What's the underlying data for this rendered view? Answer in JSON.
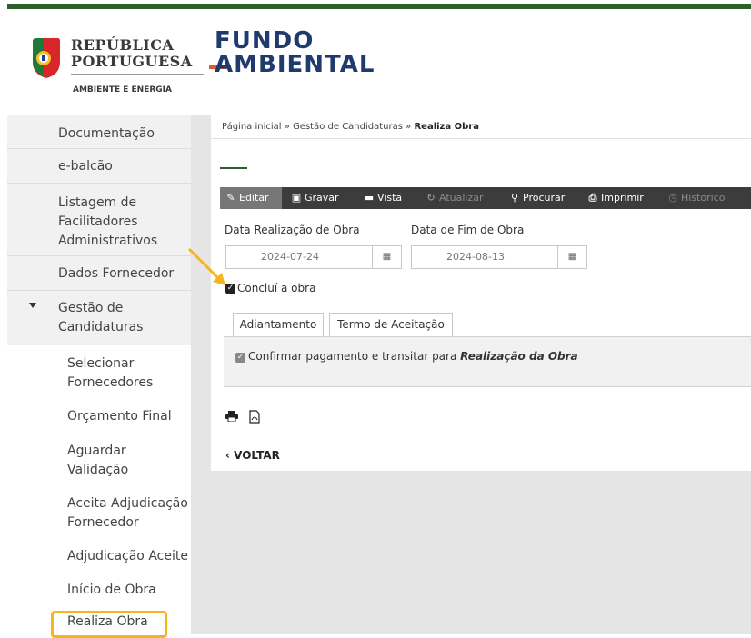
{
  "header": {
    "republica_line1": "REPÚBLICA",
    "republica_line2": "PORTUGUESA",
    "republica_sub": "AMBIENTE E ENERGIA",
    "fundo_line1": "FUNDO",
    "fundo_line2": "AMBIENTAL"
  },
  "sidebar": {
    "items": [
      {
        "label": "Documentação"
      },
      {
        "label": "e-balcão"
      },
      {
        "label": "Listagem de Facilitadores Administrativos"
      },
      {
        "label": "Dados Fornecedor"
      },
      {
        "label": "Gestão de Candidaturas"
      }
    ],
    "subitems": [
      {
        "label": "Selecionar Fornecedores"
      },
      {
        "label": "Orçamento Final"
      },
      {
        "label": "Aguardar Validação"
      },
      {
        "label": "Aceita Adjudicação Fornecedor"
      },
      {
        "label": "Adjudicação Aceite"
      },
      {
        "label": "Início de Obra"
      },
      {
        "label": "Realiza Obra"
      }
    ]
  },
  "breadcrumb": {
    "home": "Página inicial",
    "sep": "»",
    "level2": "Gestão de Candidaturas",
    "current": "Realiza Obra"
  },
  "toolbar": {
    "editar": "Editar",
    "gravar": "Gravar",
    "vista": "Vista",
    "atualizar": "Atualizar",
    "procurar": "Procurar",
    "imprimir": "Imprimir",
    "historico": "Historico"
  },
  "form": {
    "data_realizacao_label": "Data Realização de Obra",
    "data_realizacao_value": "2024-07-24",
    "data_fim_label": "Data de Fim de Obra",
    "data_fim_value": "2024-08-13",
    "conclui_label": "Concluí a obra",
    "conclui_checked": true
  },
  "tabs": [
    {
      "label": "Adiantamento"
    },
    {
      "label": "Termo de Aceitação"
    }
  ],
  "tab_panel": {
    "confirm_text": "Confirmar pagamento e transitar para",
    "confirm_bold": "Realização da Obra"
  },
  "footer": {
    "back_label": "VOLTAR"
  },
  "colors": {
    "accent_green": "#2e5e2e",
    "highlight": "#f6b51c",
    "toolbar_bg": "#3c3c3c"
  }
}
